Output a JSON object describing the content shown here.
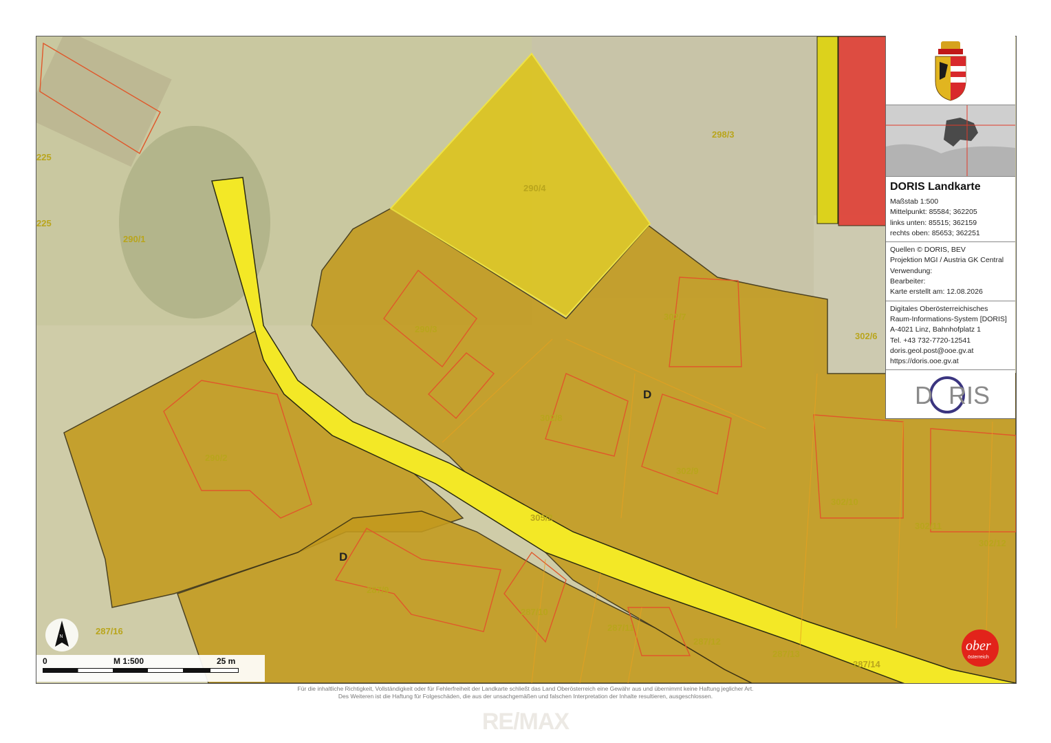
{
  "map": {
    "parcels": [
      {
        "id": "298/3"
      },
      {
        "id": "290/4"
      },
      {
        "id": "290/1"
      },
      {
        "id": "290/3"
      },
      {
        "id": "290/2"
      },
      {
        "id": "302/7"
      },
      {
        "id": "302/6"
      },
      {
        "id": "302/8"
      },
      {
        "id": "302/9"
      },
      {
        "id": "302/10"
      },
      {
        "id": "302/11"
      },
      {
        "id": "302/12"
      },
      {
        "id": "305/2"
      },
      {
        "id": "287/9"
      },
      {
        "id": "287/10"
      },
      {
        "id": "287/11"
      },
      {
        "id": "287/12"
      },
      {
        "id": "287/13"
      },
      {
        "id": "287/14"
      },
      {
        "id": "287/16"
      },
      {
        "id": "225"
      },
      {
        "id": "225"
      }
    ],
    "zone_labels": [
      "D",
      "D"
    ],
    "colors": {
      "orange_zone": "#c9a01e",
      "yellow_road": "#f4ea28",
      "yellow_parcel": "#e2cc24",
      "red_zone": "#e0443c",
      "parcel_border": "#e0572a"
    }
  },
  "panel": {
    "title": "DORIS Landkarte",
    "scale_line": "Maßstab 1:500",
    "center_line": "Mittelpunkt: 85584; 362205",
    "bottom_left_line": "links unten: 85515; 362159",
    "top_right_line": "rechts oben: 85653; 362251",
    "sources_line": "Quellen © DORIS, BEV",
    "projection_line": "Projektion MGI / Austria GK Central",
    "usage_line": "Verwendung:",
    "editor_line": "Bearbeiter:",
    "created_line": "Karte erstellt am: 12.08.2026",
    "org_line1": "Digitales Oberösterreichisches",
    "org_line2": "Raum-Informations-System [DORIS]",
    "address_line": "A-4021 Linz, Bahnhofplatz 1",
    "phone_line": "Tel. +43 732-7720-12541",
    "email_line": "doris.geol.post@ooe.gv.at",
    "web_line": "https://doris.ooe.gv.at",
    "logo_text_left": "D",
    "logo_text_right": "RIS"
  },
  "scalebar": {
    "start": "0",
    "middle": "M 1:500",
    "end": "25 m"
  },
  "north_label": "N",
  "ober_logo": {
    "line1": "ober",
    "line2": "österreich"
  },
  "footer": {
    "line1": "Für die inhaltliche Richtigkeit, Vollständigkeit oder für Fehlerfreiheit der Landkarte schließt das Land Oberösterreich eine Gewähr aus und übernimmt keine Haftung jeglicher Art.",
    "line2": "Des Weiteren ist die Haftung für Folgeschäden, die aus der unsachgemäßen und falschen Interpretation der Inhalte resultieren, ausgeschlossen."
  },
  "watermark": "RE/MAX"
}
